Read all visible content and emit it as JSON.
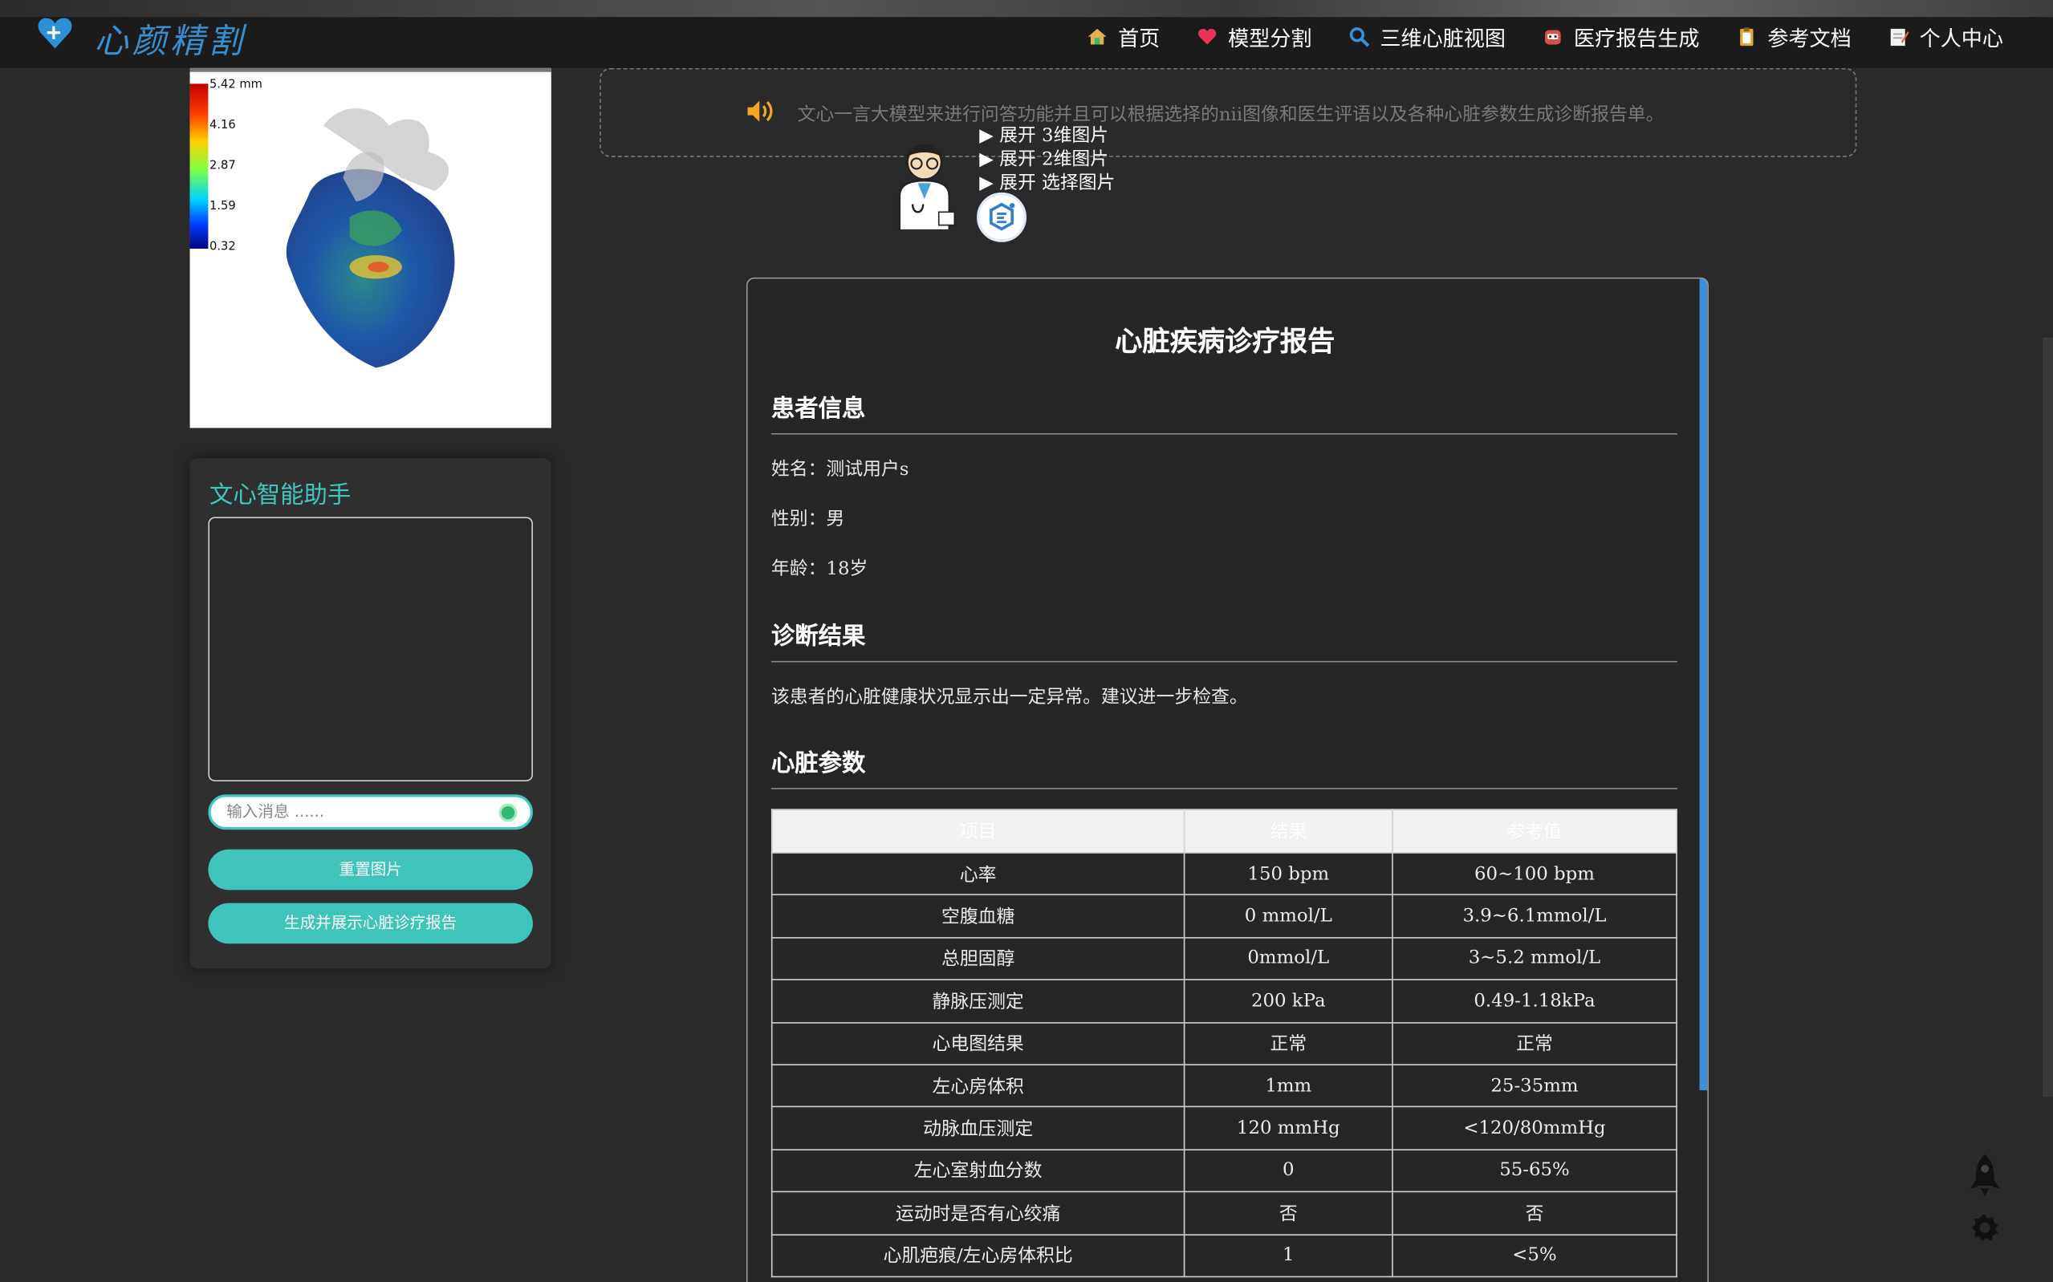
{
  "brand": {
    "name": "心颜精割"
  },
  "nav": [
    {
      "label": "首页",
      "icon": "home-icon",
      "color": "#3cb371"
    },
    {
      "label": "模型分割",
      "icon": "heart-icon",
      "color": "#e8335a"
    },
    {
      "label": "三维心脏视图",
      "icon": "magnifier-icon",
      "color": "#3a8fd6"
    },
    {
      "label": "医疗报告生成",
      "icon": "robot-icon",
      "color": "#d94f4f"
    },
    {
      "label": "参考文档",
      "icon": "clipboard-icon",
      "color": "#e3a43a"
    },
    {
      "label": "个人中心",
      "icon": "memo-icon",
      "color": "#e8e8e8"
    }
  ],
  "colorbar": {
    "labels": [
      "5.42 mm",
      "4.16",
      "2.87",
      "1.59",
      "0.32"
    ]
  },
  "assistant": {
    "title": "文心智能助手",
    "placeholder": "输入消息 ......",
    "reset_label": "重置图片",
    "generate_label": "生成并展示心脏诊疗报告"
  },
  "notice": {
    "text": "文心一言大模型来进行问答功能并且可以根据选择的nii图像和医生评语以及各种心脏参数生成诊断报告单。"
  },
  "expanders": [
    "▶ 展开 3维图片",
    "▶ 展开 2维图片",
    "▶ 展开 选择图片"
  ],
  "report": {
    "title": "心脏疾病诊疗报告",
    "patient_heading": "患者信息",
    "name": "姓名：测试用户s",
    "gender": "性别：男",
    "age": "年龄：18岁",
    "diagnosis_heading": "诊断结果",
    "diagnosis": "该患者的心脏健康状况显示出一定异常。建议进一步检查。",
    "params_heading": "心脏参数",
    "columns": [
      "项目",
      "结果",
      "参考值"
    ],
    "rows": [
      [
        "心率",
        "150 bpm",
        "60~100 bpm"
      ],
      [
        "空腹血糖",
        "0 mmol/L",
        "3.9~6.1mmol/L"
      ],
      [
        "总胆固醇",
        "0mmol/L",
        "3~5.2 mmol/L"
      ],
      [
        "静脉压测定",
        "200 kPa",
        "0.49-1.18kPa"
      ],
      [
        "心电图结果",
        "正常",
        "正常"
      ],
      [
        "左心房体积",
        "1mm",
        "25-35mm"
      ],
      [
        "动脉血压测定",
        "120 mmHg",
        "<120/80mmHg"
      ],
      [
        "左心室射血分数",
        "0",
        "55-65%"
      ],
      [
        "运动时是否有心绞痛",
        "否",
        "否"
      ],
      [
        "心肌疤痕/左心房体积比",
        "1",
        "<5%"
      ]
    ]
  },
  "floating": {
    "rocket_icon": "rocket-icon",
    "settings_icon": "gear-icon"
  },
  "accent": "#3ec4bb"
}
